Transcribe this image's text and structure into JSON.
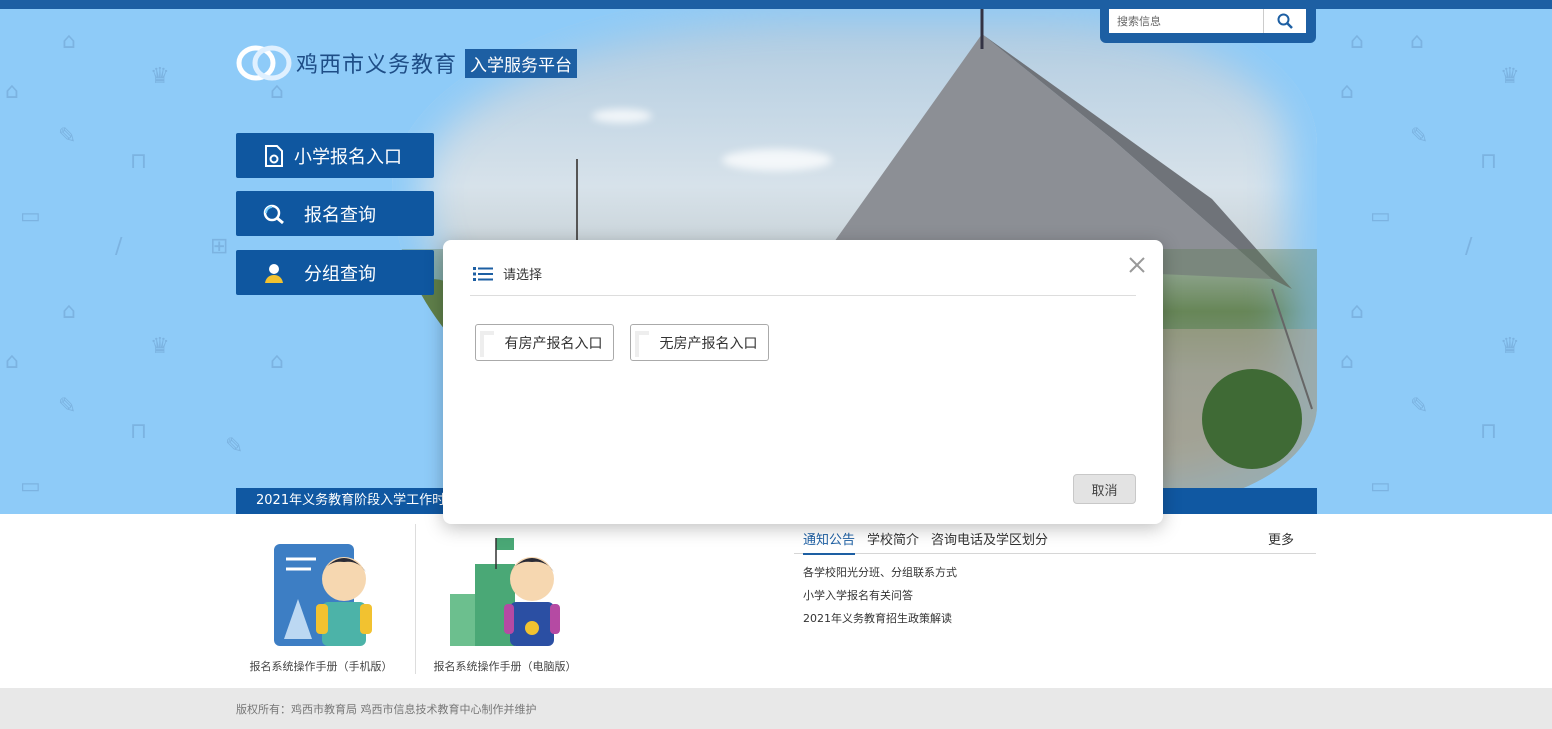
{
  "header": {
    "search": {
      "placeholder": "搜索信息"
    },
    "logo": {
      "name": "鸡西市义务教育",
      "badge": "入学服务平台"
    }
  },
  "nav": {
    "items": [
      {
        "label": "小学报名入口",
        "icon": "form-document-icon"
      },
      {
        "label": "报名查询",
        "icon": "magnifier-icon"
      },
      {
        "label": "分组查询",
        "icon": "user-icon"
      }
    ]
  },
  "ticker": {
    "text": "2021年义务教育阶段入学工作时间"
  },
  "manuals": [
    {
      "caption": "报名系统操作手册（手机版）"
    },
    {
      "caption": "报名系统操作手册（电脑版）"
    }
  ],
  "notices": {
    "tabs": [
      "通知公告",
      "学校简介",
      "咨询电话及学区划分"
    ],
    "more": "更多",
    "items": [
      "各学校阳光分班、分组联系方式",
      "小学入学报名有关问答",
      "2021年义务教育招生政策解读"
    ]
  },
  "footer": {
    "text": "版权所有：鸡西市教育局 鸡西市信息技术教育中心制作并维护"
  },
  "modal": {
    "title": "请选择",
    "options": [
      "有房产报名入口",
      "无房产报名入口"
    ],
    "cancel": "取消"
  },
  "colors": {
    "primary": "#1d5fa3",
    "nav": "#0f57a0",
    "sky": "#8ecbf8"
  }
}
